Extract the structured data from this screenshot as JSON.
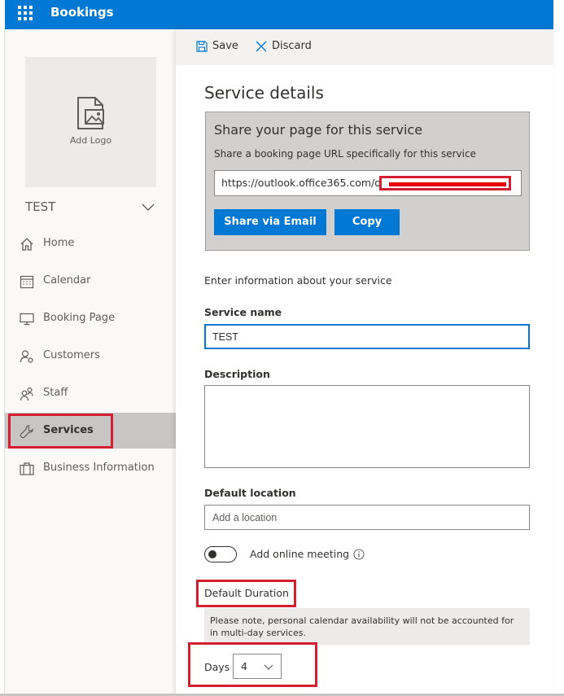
{
  "app": {
    "title": "Bookings"
  },
  "sidebar": {
    "logo_label": "Add Logo",
    "business_name": "TEST",
    "items": [
      {
        "label": "Home",
        "icon": "home-icon"
      },
      {
        "label": "Calendar",
        "icon": "calendar-icon"
      },
      {
        "label": "Booking Page",
        "icon": "monitor-icon"
      },
      {
        "label": "Customers",
        "icon": "customers-icon"
      },
      {
        "label": "Staff",
        "icon": "staff-icon"
      },
      {
        "label": "Services",
        "icon": "wrench-icon",
        "active": true
      },
      {
        "label": "Business Information",
        "icon": "briefcase-icon"
      }
    ]
  },
  "commands": {
    "save": "Save",
    "discard": "Discard"
  },
  "panel": {
    "title": "Service details",
    "share": {
      "title": "Share your page for this service",
      "subtitle": "Share a booking page URL specifically for this service",
      "url": "https://outlook.office365.com/o",
      "email_button": "Share via Email",
      "copy_button": "Copy"
    },
    "form_hint": "Enter information about your service",
    "service_name": {
      "label": "Service name",
      "value": "TEST"
    },
    "description": {
      "label": "Description"
    },
    "location": {
      "label": "Default location",
      "placeholder": "Add a location"
    },
    "online_meeting": {
      "label": "Add online meeting",
      "enabled": false
    },
    "duration": {
      "label": "Default Duration",
      "notice": "Please note, personal calendar availability will not be accounted for in multi-day services.",
      "days_label": "Days",
      "days_value": "4"
    }
  },
  "colors": {
    "brand": "#0078d4",
    "highlight": "#d32030"
  }
}
